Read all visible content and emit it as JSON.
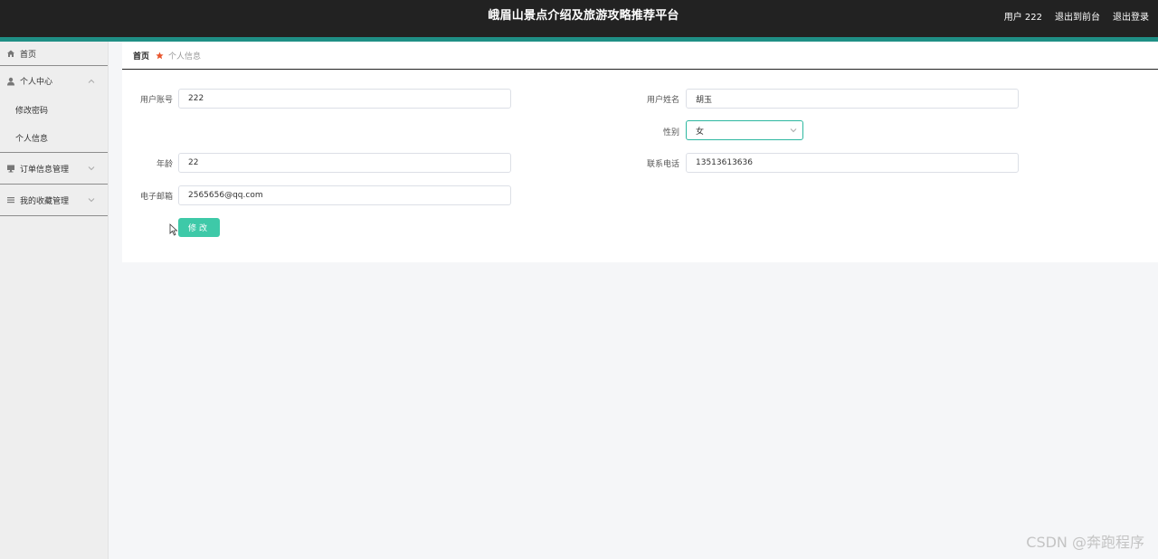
{
  "header": {
    "title": "峨眉山景点介绍及旅游攻略推荐平台",
    "user_label": "用户 222",
    "back_to_front": "退出到前台",
    "logout": "退出登录"
  },
  "sidebar": {
    "home": "首页",
    "personal_center": "个人中心",
    "change_password": "修改密码",
    "personal_info": "个人信息",
    "order_management": "订单信息管理",
    "favorites_management": "我的收藏管理"
  },
  "breadcrumb": {
    "home": "首页",
    "current": "个人信息"
  },
  "form": {
    "account_label": "用户账号",
    "account_value": "222",
    "name_label": "用户姓名",
    "name_value": "胡玉",
    "gender_label": "性别",
    "gender_value": "女",
    "age_label": "年龄",
    "age_value": "22",
    "phone_label": "联系电话",
    "phone_value": "13513613636",
    "email_label": "电子邮箱",
    "email_value": "2565656@qq.com",
    "submit_label": "修改"
  },
  "watermark": "CSDN @奔跑程序",
  "colors": {
    "topbar": "#222222",
    "accent": "#1f8f85",
    "button": "#3ec9a8"
  }
}
